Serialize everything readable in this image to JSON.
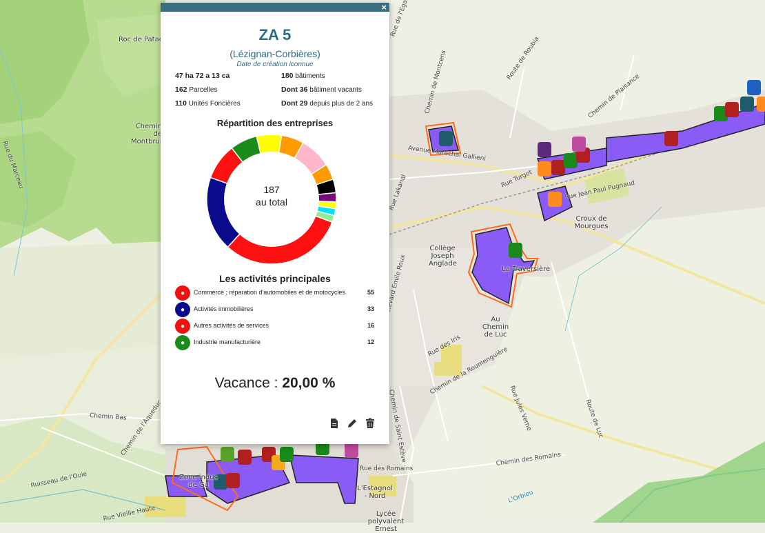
{
  "popup": {
    "close_label": "×",
    "title": "ZA 5",
    "subtitle": "(Lézignan-Corbières)",
    "created": "Date de création iconnue",
    "stats": {
      "area_bold": "47 ha 72 a 13 ca",
      "buildings_bold": "180",
      "buildings_label": "bâtiments",
      "parcels_bold": "162",
      "parcels_label": "Parcelles",
      "vacant_bold": "Dont 36",
      "vacant_label": "bâtiment vacants",
      "units_bold": "110",
      "units_label": "Unités Foncières",
      "old_vacant_bold": "Dont 29",
      "old_vacant_label": "depuis plus de 2 ans"
    },
    "repartition_title": "Répartition des entreprises",
    "donut_total": "187",
    "donut_total_label": "au total",
    "activities_title": "Les activités principales",
    "activities": [
      {
        "label": "Commerce ; réparation d'automobiles et de motocycles",
        "count": "55",
        "color": "#ee1111",
        "icon": "car-icon"
      },
      {
        "label": "Activités immobilières",
        "count": "33",
        "color": "#0a0a8c",
        "icon": "building-icon"
      },
      {
        "label": "Autres activités de services",
        "count": "16",
        "color": "#ee1111",
        "icon": "service-icon"
      },
      {
        "label": "Industrie manufacturière",
        "count": "12",
        "color": "#1a8a1a",
        "icon": "factory-icon"
      }
    ],
    "vacance_label": "Vacance :",
    "vacance_value": "20,00 %"
  },
  "chart_data": {
    "type": "pie",
    "title": "Répartition des entreprises",
    "slices": [
      {
        "color": "#ff1111",
        "value": 55
      },
      {
        "color": "#0a0a8c",
        "value": 33
      },
      {
        "color": "#ff1111",
        "value": 16
      },
      {
        "color": "#1a8a1a",
        "value": 12
      },
      {
        "color": "#ffff00",
        "value": 11
      },
      {
        "color": "#ff9a00",
        "value": 10
      },
      {
        "color": "#ffb6c8",
        "value": 14
      },
      {
        "color": "#ff9a00",
        "value": 7
      },
      {
        "color": "#000000",
        "value": 6
      },
      {
        "color": "#7a0a7a",
        "value": 4
      },
      {
        "color": "#ffff00",
        "value": 3
      },
      {
        "color": "#00e0ff",
        "value": 3
      },
      {
        "color": "#90ee90",
        "value": 3
      }
    ],
    "center_text": "187 au total"
  },
  "map": {
    "labels": {
      "roc": "Roc de Pataco",
      "chemin_montbrun": "Chemin de Montbrun",
      "college": "Collège Joseph Anglade",
      "croux": "Croux de Mourgues",
      "traversiere": "La Traversière",
      "chemin_luc": "Au Chemin de Luc",
      "estagnol": "L'Estagnol - Nord",
      "lycee": "Lycée polyvalent Ernest",
      "zone": "Zone indus de Ga"
    },
    "roads": {
      "roubia": "Route de Roubia",
      "egalite": "Rue de l'Egalité",
      "montcens": "Chemin de Montcens",
      "plaisance": "Chemin de Plaisance",
      "gallieni": "Avenue Maréchal Gallieni",
      "turgot": "Rue Turgot",
      "paul": "Rue Jean Paul Pugnaud",
      "bas": "Chemin Bas",
      "aqueduc": "Chemin de l'Aqueduc",
      "romains1": "Rue des Romains",
      "romains2": "Chemin des Romains",
      "iris": "Rue des Iris",
      "roumenguiere": "Chemin de la Roumenguière",
      "jules": "Rue Jules Verne",
      "estevre": "Chemin de Saint Estève",
      "luc": "Route de Luc",
      "ouie": "Ruisseau de l'Ouie",
      "vieille": "Rue Vieille Haute",
      "orbieu": "L'Orbieu",
      "marceau": "Rue du Marceau",
      "lakanal": "Rue Lakanal",
      "hautz": "Boulevard Emile Roux"
    }
  }
}
